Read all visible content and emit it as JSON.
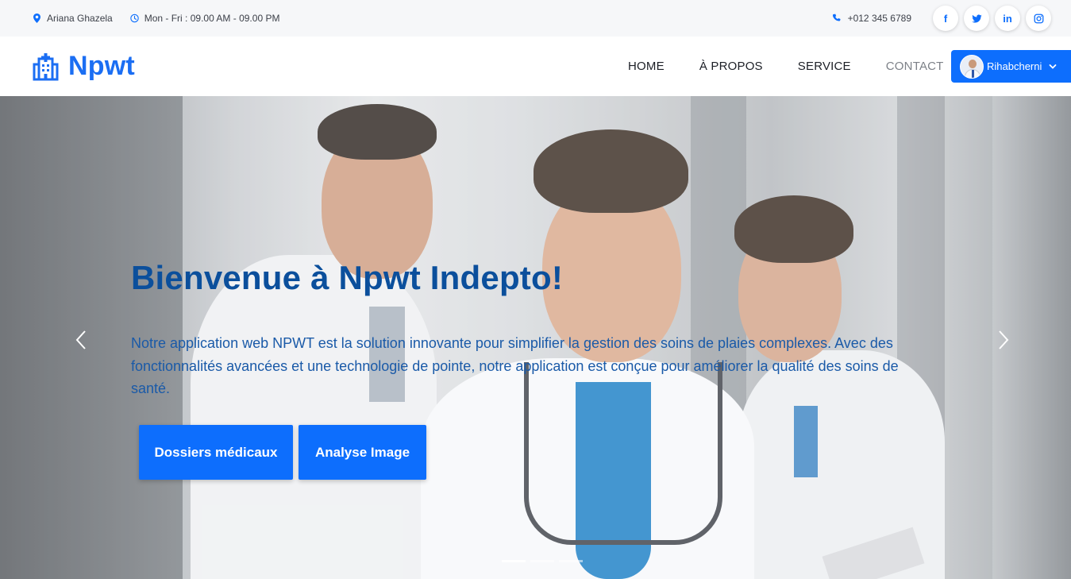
{
  "topbar": {
    "location": "Ariana Ghazela",
    "hours": "Mon - Fri : 09.00 AM - 09.00 PM",
    "phone": "+012 345 6789",
    "social": [
      {
        "name": "facebook",
        "label": "f"
      },
      {
        "name": "twitter",
        "label": ""
      },
      {
        "name": "linkedin",
        "label": "in"
      },
      {
        "name": "instagram",
        "label": ""
      }
    ]
  },
  "navbar": {
    "brand": "Npwt",
    "links": [
      "HOME",
      "À PROPOS",
      "SERVICE",
      "CONTACT"
    ],
    "active_link": "CONTACT",
    "user_name": "Rihabcherni"
  },
  "hero": {
    "title": "Bienvenue à Npwt Indepto!",
    "lead": "Notre application web NPWT est la solution innovante pour simplifier la gestion des soins de plaies complexes. Avec des fonctionnalités avancées et une technologie de pointe, notre application est conçue pour améliorer la qualité des soins de santé.",
    "buttons": [
      "Dossiers médicaux",
      "Analyse Image"
    ],
    "slide_count": 3,
    "active_slide": 1
  },
  "colors": {
    "primary": "#0d6efd",
    "brand": "#1b6ef3",
    "hero_title": "#0b4f9c",
    "hero_text": "#1a5aa8"
  }
}
